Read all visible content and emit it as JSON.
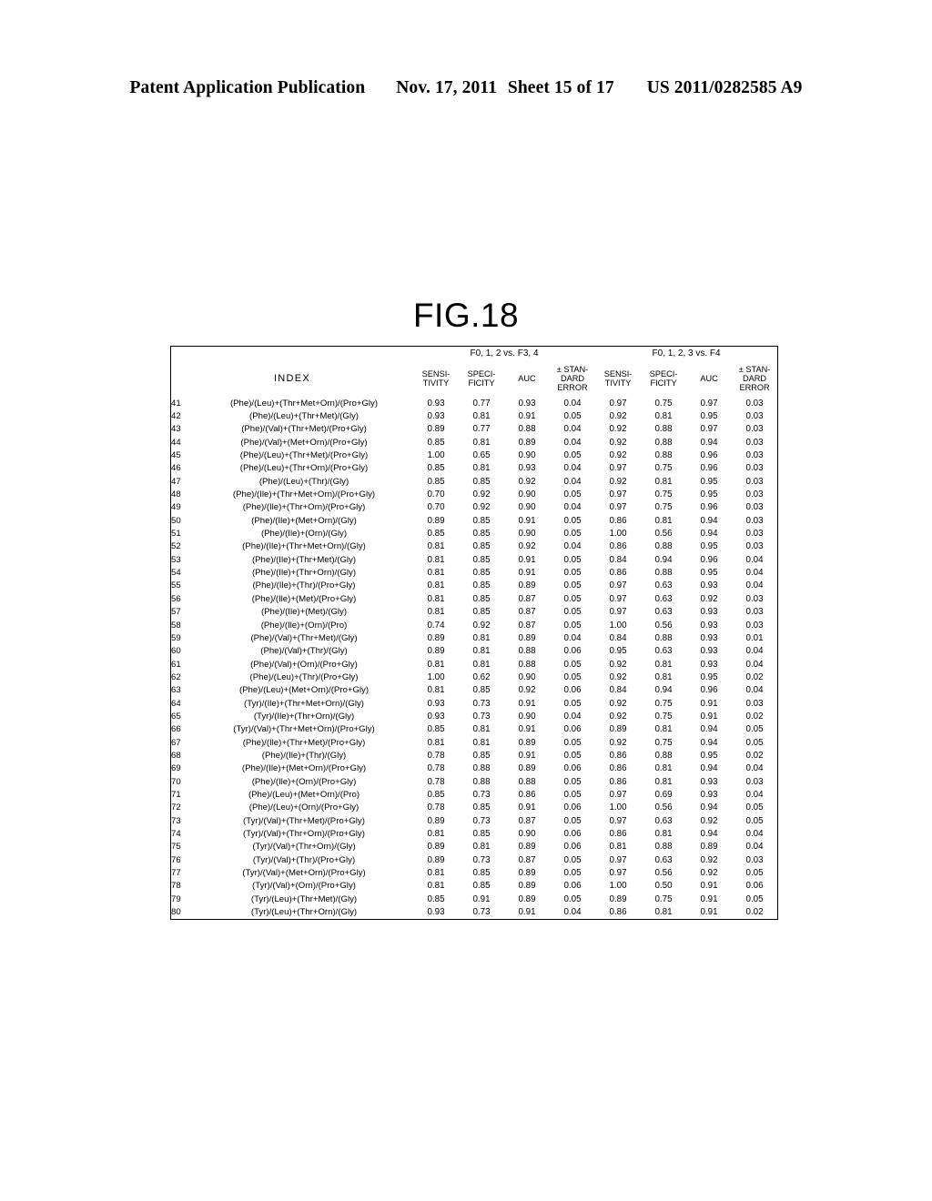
{
  "header": {
    "publication": "Patent Application Publication",
    "date": "Nov. 17, 2011",
    "sheet": "Sheet 15 of 17",
    "number": "US 2011/0282585 A9"
  },
  "figure": {
    "title": "FIG.18"
  },
  "table": {
    "index_header": "INDEX",
    "group_headers": [
      "F0, 1, 2 vs. F3, 4",
      "F0, 1, 2, 3 vs. F4"
    ],
    "metric_headers": [
      "SENSI-\nTIVITY",
      "SPECI-\nFICITY",
      "AUC",
      "± STAN-\nDARD\nERROR"
    ],
    "metric_headers_lines": {
      "sensitivity": [
        "SENSI-",
        "TIVITY"
      ],
      "specificity": [
        "SPECI-",
        "FICITY"
      ],
      "auc": [
        "AUC"
      ],
      "stderr": [
        "± STAN-",
        "DARD",
        "ERROR"
      ]
    },
    "rows": [
      {
        "idx": "41",
        "name": "(Phe)/(Leu)+(Thr+Met+Orn)/(Pro+Gly)",
        "g1": [
          "0.93",
          "0.77",
          "0.93",
          "0.04"
        ],
        "g2": [
          "0.97",
          "0.75",
          "0.97",
          "0.03"
        ]
      },
      {
        "idx": "42",
        "name": "(Phe)/(Leu)+(Thr+Met)/(Gly)",
        "g1": [
          "0.93",
          "0.81",
          "0.91",
          "0.05"
        ],
        "g2": [
          "0.92",
          "0.81",
          "0.95",
          "0.03"
        ]
      },
      {
        "idx": "43",
        "name": "(Phe)/(Val)+(Thr+Met)/(Pro+Gly)",
        "g1": [
          "0.89",
          "0.77",
          "0.88",
          "0.04"
        ],
        "g2": [
          "0.92",
          "0.88",
          "0.97",
          "0.03"
        ]
      },
      {
        "idx": "44",
        "name": "(Phe)/(Val)+(Met+Orn)/(Pro+Gly)",
        "g1": [
          "0.85",
          "0.81",
          "0.89",
          "0.04"
        ],
        "g2": [
          "0.92",
          "0.88",
          "0.94",
          "0.03"
        ]
      },
      {
        "idx": "45",
        "name": "(Phe)/(Leu)+(Thr+Met)/(Pro+Gly)",
        "g1": [
          "1.00",
          "0.65",
          "0.90",
          "0.05"
        ],
        "g2": [
          "0.92",
          "0.88",
          "0.96",
          "0.03"
        ]
      },
      {
        "idx": "46",
        "name": "(Phe)/(Leu)+(Thr+Orn)/(Pro+Gly)",
        "g1": [
          "0.85",
          "0.81",
          "0.93",
          "0.04"
        ],
        "g2": [
          "0.97",
          "0.75",
          "0.96",
          "0.03"
        ]
      },
      {
        "idx": "47",
        "name": "(Phe)/(Leu)+(Thr)/(Gly)",
        "g1": [
          "0.85",
          "0.85",
          "0.92",
          "0.04"
        ],
        "g2": [
          "0.92",
          "0.81",
          "0.95",
          "0.03"
        ]
      },
      {
        "idx": "48",
        "name": "(Phe)/(Ile)+(Thr+Met+Orn)/(Pro+Gly)",
        "g1": [
          "0.70",
          "0.92",
          "0.90",
          "0.05"
        ],
        "g2": [
          "0.97",
          "0.75",
          "0.95",
          "0.03"
        ]
      },
      {
        "idx": "49",
        "name": "(Phe)/(Ile)+(Thr+Orn)/(Pro+Gly)",
        "g1": [
          "0.70",
          "0.92",
          "0.90",
          "0.04"
        ],
        "g2": [
          "0.97",
          "0.75",
          "0.96",
          "0.03"
        ]
      },
      {
        "idx": "50",
        "name": "(Phe)/(Ile)+(Met+Orn)/(Gly)",
        "g1": [
          "0.89",
          "0.85",
          "0.91",
          "0.05"
        ],
        "g2": [
          "0.86",
          "0.81",
          "0.94",
          "0.03"
        ]
      },
      {
        "idx": "51",
        "name": "(Phe)/(Ile)+(Orn)/(Gly)",
        "g1": [
          "0.85",
          "0.85",
          "0.90",
          "0.05"
        ],
        "g2": [
          "1.00",
          "0.56",
          "0.94",
          "0.03"
        ]
      },
      {
        "idx": "52",
        "name": "(Phe)/(Ile)+(Thr+Met+Orn)/(Gly)",
        "g1": [
          "0.81",
          "0.85",
          "0.92",
          "0.04"
        ],
        "g2": [
          "0.86",
          "0.88",
          "0.95",
          "0.03"
        ]
      },
      {
        "idx": "53",
        "name": "(Phe)/(Ile)+(Thr+Met)/(Gly)",
        "g1": [
          "0.81",
          "0.85",
          "0.91",
          "0.05"
        ],
        "g2": [
          "0.84",
          "0.94",
          "0.96",
          "0.04"
        ]
      },
      {
        "idx": "54",
        "name": "(Phe)/(Ile)+(Thr+Orn)/(Gly)",
        "g1": [
          "0.81",
          "0.85",
          "0.91",
          "0.05"
        ],
        "g2": [
          "0.86",
          "0.88",
          "0.95",
          "0.04"
        ]
      },
      {
        "idx": "55",
        "name": "(Phe)/(Ile)+(Thr)/(Pro+Gly)",
        "g1": [
          "0.81",
          "0.85",
          "0.89",
          "0.05"
        ],
        "g2": [
          "0.97",
          "0.63",
          "0.93",
          "0.04"
        ]
      },
      {
        "idx": "56",
        "name": "(Phe)/(Ile)+(Met)/(Pro+Gly)",
        "g1": [
          "0.81",
          "0.85",
          "0.87",
          "0.05"
        ],
        "g2": [
          "0.97",
          "0.63",
          "0.92",
          "0.03"
        ]
      },
      {
        "idx": "57",
        "name": "(Phe)/(Ile)+(Met)/(Gly)",
        "g1": [
          "0.81",
          "0.85",
          "0.87",
          "0.05"
        ],
        "g2": [
          "0.97",
          "0.63",
          "0.93",
          "0.03"
        ]
      },
      {
        "idx": "58",
        "name": "(Phe)/(Ile)+(Orn)/(Pro)",
        "g1": [
          "0.74",
          "0.92",
          "0.87",
          "0.05"
        ],
        "g2": [
          "1.00",
          "0.56",
          "0.93",
          "0.03"
        ]
      },
      {
        "idx": "59",
        "name": "(Phe)/(Val)+(Thr+Met)/(Gly)",
        "g1": [
          "0.89",
          "0.81",
          "0.89",
          "0.04"
        ],
        "g2": [
          "0.84",
          "0.88",
          "0.93",
          "0.01"
        ]
      },
      {
        "idx": "60",
        "name": "(Phe)/(Val)+(Thr)/(Gly)",
        "g1": [
          "0.89",
          "0.81",
          "0.88",
          "0.06"
        ],
        "g2": [
          "0.95",
          "0.63",
          "0.93",
          "0.04"
        ]
      },
      {
        "idx": "61",
        "name": "(Phe)/(Val)+(Orn)/(Pro+Gly)",
        "g1": [
          "0.81",
          "0.81",
          "0.88",
          "0.05"
        ],
        "g2": [
          "0.92",
          "0.81",
          "0.93",
          "0.04"
        ]
      },
      {
        "idx": "62",
        "name": "(Phe)/(Leu)+(Thr)/(Pro+Gly)",
        "g1": [
          "1.00",
          "0.62",
          "0.90",
          "0.05"
        ],
        "g2": [
          "0.92",
          "0.81",
          "0.95",
          "0.02"
        ]
      },
      {
        "idx": "63",
        "name": "(Phe)/(Leu)+(Met+Orn)/(Pro+Gly)",
        "g1": [
          "0.81",
          "0.85",
          "0.92",
          "0.06"
        ],
        "g2": [
          "0.84",
          "0.94",
          "0.96",
          "0.04"
        ]
      },
      {
        "idx": "64",
        "name": "(Tyr)/(Ile)+(Thr+Met+Orn)/(Gly)",
        "g1": [
          "0.93",
          "0.73",
          "0.91",
          "0.05"
        ],
        "g2": [
          "0.92",
          "0.75",
          "0.91",
          "0.03"
        ]
      },
      {
        "idx": "65",
        "name": "(Tyr)/(Ile)+(Thr+Orn)/(Gly)",
        "g1": [
          "0.93",
          "0.73",
          "0.90",
          "0.04"
        ],
        "g2": [
          "0.92",
          "0.75",
          "0.91",
          "0.02"
        ]
      },
      {
        "idx": "66",
        "name": "(Tyr)/(Val)+(Thr+Met+Orn)/(Pro+Gly)",
        "g1": [
          "0.85",
          "0.81",
          "0.91",
          "0.06"
        ],
        "g2": [
          "0.89",
          "0.81",
          "0.94",
          "0.05"
        ]
      },
      {
        "idx": "67",
        "name": "(Phe)/(Ile)+(Thr+Met)/(Pro+Gly)",
        "g1": [
          "0.81",
          "0.81",
          "0.89",
          "0.05"
        ],
        "g2": [
          "0.92",
          "0.75",
          "0.94",
          "0.05"
        ]
      },
      {
        "idx": "68",
        "name": "(Phe)/(Ile)+(Thr)/(Gly)",
        "g1": [
          "0.78",
          "0.85",
          "0.91",
          "0.05"
        ],
        "g2": [
          "0.86",
          "0.88",
          "0.95",
          "0.02"
        ]
      },
      {
        "idx": "69",
        "name": "(Phe)/(Ile)+(Met+Orn)/(Pro+Gly)",
        "g1": [
          "0.78",
          "0.88",
          "0.89",
          "0.06"
        ],
        "g2": [
          "0.86",
          "0.81",
          "0.94",
          "0.04"
        ]
      },
      {
        "idx": "70",
        "name": "(Phe)/(Ile)+(Orn)/(Pro+Gly)",
        "g1": [
          "0.78",
          "0.88",
          "0.88",
          "0.05"
        ],
        "g2": [
          "0.86",
          "0.81",
          "0.93",
          "0.03"
        ]
      },
      {
        "idx": "71",
        "name": "(Phe)/(Leu)+(Met+Orn)/(Pro)",
        "g1": [
          "0.85",
          "0.73",
          "0.86",
          "0.05"
        ],
        "g2": [
          "0.97",
          "0.69",
          "0.93",
          "0.04"
        ]
      },
      {
        "idx": "72",
        "name": "(Phe)/(Leu)+(Orn)/(Pro+Gly)",
        "g1": [
          "0.78",
          "0.85",
          "0.91",
          "0.06"
        ],
        "g2": [
          "1.00",
          "0.56",
          "0.94",
          "0.05"
        ]
      },
      {
        "idx": "73",
        "name": "(Tyr)/(Val)+(Thr+Met)/(Pro+Gly)",
        "g1": [
          "0.89",
          "0.73",
          "0.87",
          "0.05"
        ],
        "g2": [
          "0.97",
          "0.63",
          "0.92",
          "0.05"
        ]
      },
      {
        "idx": "74",
        "name": "(Tyr)/(Val)+(Thr+Orn)/(Pro+Gly)",
        "g1": [
          "0.81",
          "0.85",
          "0.90",
          "0.06"
        ],
        "g2": [
          "0.86",
          "0.81",
          "0.94",
          "0.04"
        ]
      },
      {
        "idx": "75",
        "name": "(Tyr)/(Val)+(Thr+Orn)/(Gly)",
        "g1": [
          "0.89",
          "0.81",
          "0.89",
          "0.06"
        ],
        "g2": [
          "0.81",
          "0.88",
          "0.89",
          "0.04"
        ]
      },
      {
        "idx": "76",
        "name": "(Tyr)/(Val)+(Thr)/(Pro+Gly)",
        "g1": [
          "0.89",
          "0.73",
          "0.87",
          "0.05"
        ],
        "g2": [
          "0.97",
          "0.63",
          "0.92",
          "0.03"
        ]
      },
      {
        "idx": "77",
        "name": "(Tyr)/(Val)+(Met+Orn)/(Pro+Gly)",
        "g1": [
          "0.81",
          "0.85",
          "0.89",
          "0.05"
        ],
        "g2": [
          "0.97",
          "0.56",
          "0.92",
          "0.05"
        ]
      },
      {
        "idx": "78",
        "name": "(Tyr)/(Val)+(Orn)/(Pro+Gly)",
        "g1": [
          "0.81",
          "0.85",
          "0.89",
          "0.06"
        ],
        "g2": [
          "1.00",
          "0.50",
          "0.91",
          "0.06"
        ]
      },
      {
        "idx": "79",
        "name": "(Tyr)/(Leu)+(Thr+Met)/(Gly)",
        "g1": [
          "0.85",
          "0.91",
          "0.89",
          "0.05"
        ],
        "g2": [
          "0.89",
          "0.75",
          "0.91",
          "0.05"
        ]
      },
      {
        "idx": "80",
        "name": "(Tyr)/(Leu)+(Thr+Orn)/(Gly)",
        "g1": [
          "0.93",
          "0.73",
          "0.91",
          "0.04"
        ],
        "g2": [
          "0.86",
          "0.81",
          "0.91",
          "0.02"
        ]
      }
    ]
  }
}
